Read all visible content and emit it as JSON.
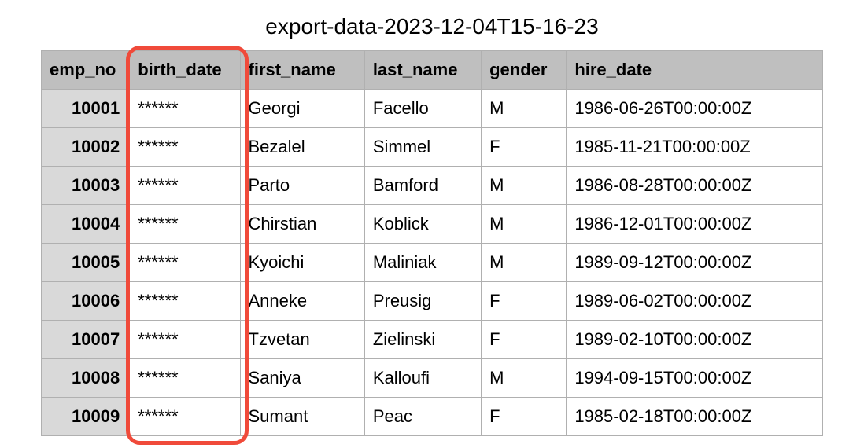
{
  "title": "export-data-2023-12-04T15-16-23",
  "columns": [
    {
      "key": "emp_no",
      "label": "emp_no"
    },
    {
      "key": "birth_date",
      "label": "birth_date"
    },
    {
      "key": "first_name",
      "label": "first_name"
    },
    {
      "key": "last_name",
      "label": "last_name"
    },
    {
      "key": "gender",
      "label": "gender"
    },
    {
      "key": "hire_date",
      "label": "hire_date"
    }
  ],
  "rows": [
    {
      "emp_no": "10001",
      "birth_date": "******",
      "first_name": "Georgi",
      "last_name": "Facello",
      "gender": "M",
      "hire_date": "1986-06-26T00:00:00Z"
    },
    {
      "emp_no": "10002",
      "birth_date": "******",
      "first_name": "Bezalel",
      "last_name": "Simmel",
      "gender": "F",
      "hire_date": "1985-11-21T00:00:00Z"
    },
    {
      "emp_no": "10003",
      "birth_date": "******",
      "first_name": "Parto",
      "last_name": "Bamford",
      "gender": "M",
      "hire_date": "1986-08-28T00:00:00Z"
    },
    {
      "emp_no": "10004",
      "birth_date": "******",
      "first_name": "Chirstian",
      "last_name": "Koblick",
      "gender": "M",
      "hire_date": "1986-12-01T00:00:00Z"
    },
    {
      "emp_no": "10005",
      "birth_date": "******",
      "first_name": "Kyoichi",
      "last_name": "Maliniak",
      "gender": "M",
      "hire_date": "1989-09-12T00:00:00Z"
    },
    {
      "emp_no": "10006",
      "birth_date": "******",
      "first_name": "Anneke",
      "last_name": "Preusig",
      "gender": "F",
      "hire_date": "1989-06-02T00:00:00Z"
    },
    {
      "emp_no": "10007",
      "birth_date": "******",
      "first_name": "Tzvetan",
      "last_name": "Zielinski",
      "gender": "F",
      "hire_date": "1989-02-10T00:00:00Z"
    },
    {
      "emp_no": "10008",
      "birth_date": "******",
      "first_name": "Saniya",
      "last_name": "Kalloufi",
      "gender": "M",
      "hire_date": "1994-09-15T00:00:00Z"
    },
    {
      "emp_no": "10009",
      "birth_date": "******",
      "first_name": "Sumant",
      "last_name": "Peac",
      "gender": "F",
      "hire_date": "1985-02-18T00:00:00Z"
    }
  ],
  "highlight_column": "birth_date"
}
